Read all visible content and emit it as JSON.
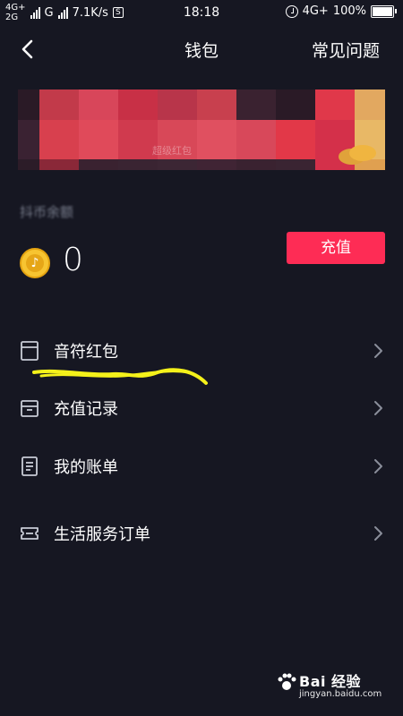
{
  "status_bar": {
    "network1": "4G+",
    "network2": "2G",
    "carrier_tag": "G",
    "speed": "7.1K/s",
    "s_icon": "S",
    "time": "18:18",
    "network_right": "4G+",
    "battery": "100%"
  },
  "header": {
    "title": "钱包",
    "faq": "常见问题"
  },
  "banner": {
    "faint_text": "超级红包"
  },
  "balance": {
    "label": "抖币余额",
    "amount": "0",
    "recharge_button": "充值"
  },
  "menu": [
    {
      "label": "音符红包",
      "icon": "envelope-icon"
    },
    {
      "label": "充值记录",
      "icon": "archive-box-icon"
    },
    {
      "label": "我的账单",
      "icon": "document-icon"
    },
    {
      "label": "生活服务订单",
      "icon": "ticket-icon"
    }
  ],
  "watermark": {
    "main": "Bai 经验",
    "sub": "jingyan.baidu.com"
  },
  "colors": {
    "background": "#161722",
    "accent": "#fe2c55",
    "coin": "#f7c431",
    "highlight": "#f4f11a"
  }
}
